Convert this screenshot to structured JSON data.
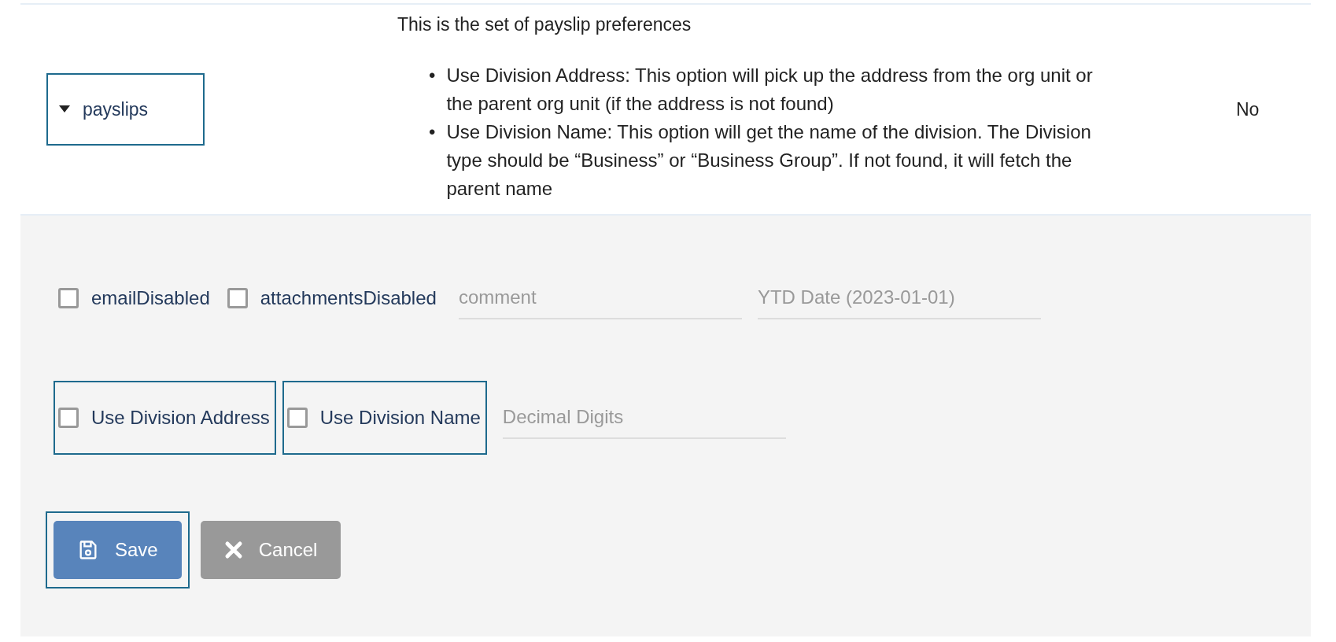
{
  "preference": {
    "name": "payslips",
    "expanded": true,
    "focused": true,
    "description": "This is the set of payslip preferences",
    "bullets": [
      {
        "marker": "•",
        "text": "Use Division Address: This option will pick up the address from the org unit or the parent org unit (if the address is not found)"
      },
      {
        "marker": "•",
        "text": "Use Division Name: This option will get the name of the division. The Division type should be “Business” or “Business Group”. If not found, it will fetch the parent name"
      }
    ],
    "value": "No"
  },
  "form": {
    "rows": [
      {
        "items": [
          {
            "kind": "checkbox",
            "label": "emailDisabled",
            "checked": false,
            "focused": false
          },
          {
            "kind": "checkbox",
            "label": "attachmentsDisabled",
            "checked": false,
            "focused": false
          },
          {
            "kind": "field",
            "placeholder": "comment"
          },
          {
            "kind": "field",
            "placeholder": "YTD Date (2023-01-01)"
          }
        ]
      },
      {
        "items": [
          {
            "kind": "checkbox",
            "label": "Use Division Address",
            "checked": false,
            "focused": true
          },
          {
            "kind": "checkbox",
            "label": "Use Division Name",
            "checked": false,
            "focused": true
          },
          {
            "kind": "field",
            "placeholder": "Decimal Digits"
          }
        ]
      }
    ],
    "buttons": [
      {
        "kind": "save",
        "label": "Save",
        "focused": true
      },
      {
        "kind": "cancel",
        "label": "Cancel"
      }
    ]
  }
}
